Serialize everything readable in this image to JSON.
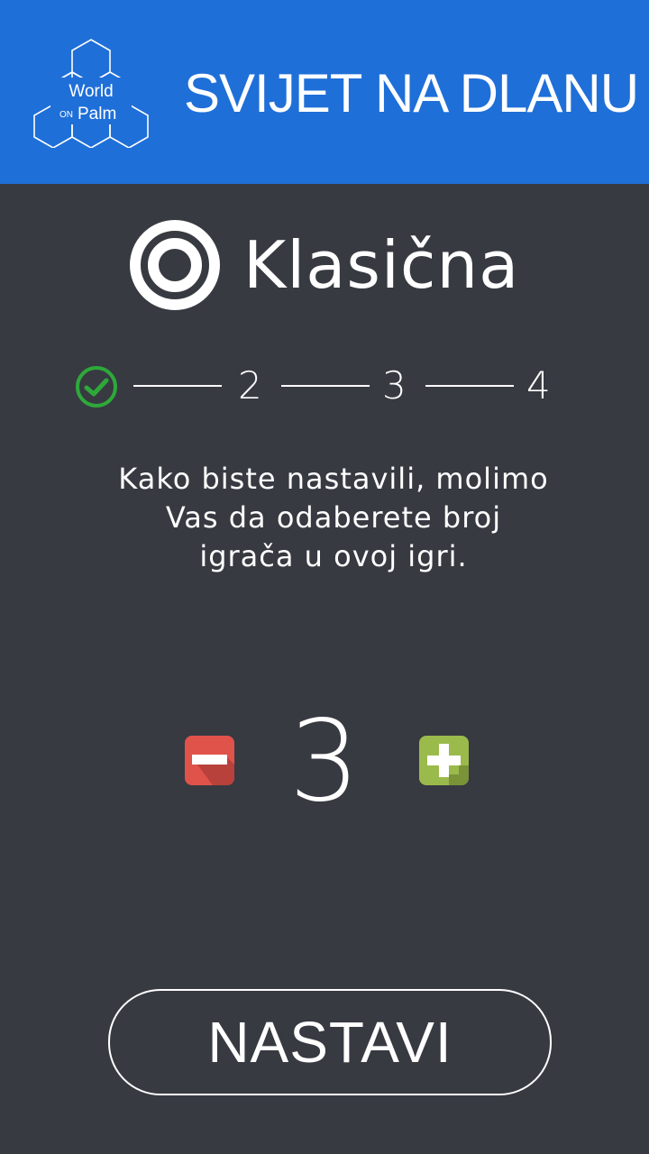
{
  "header": {
    "logo_icon": "world-on-palm-logo",
    "logo_text_top": "World",
    "logo_text_on": "ON",
    "logo_text_bottom": "Palm",
    "title": "SVIJET NA DLANU",
    "background_color": "#1f6fd8"
  },
  "mode": {
    "icon": "target-ring-icon",
    "title": "Klasična"
  },
  "steps": {
    "completed_icon": "check-circle-icon",
    "completed_color": "#2ea83a",
    "items": [
      "2",
      "3",
      "4"
    ]
  },
  "instruction": {
    "lines": [
      "Kako biste nastavili, molimo",
      "Vas da odaberete broj",
      "igrača u ovoj igri."
    ]
  },
  "player_count": {
    "value": "3",
    "decrement_icon": "minus-icon",
    "decrement_color": "#e0534a",
    "increment_icon": "plus-icon",
    "increment_color": "#9bba4c"
  },
  "actions": {
    "next_label": "NASTAVI"
  },
  "colors": {
    "background": "#373a41"
  }
}
